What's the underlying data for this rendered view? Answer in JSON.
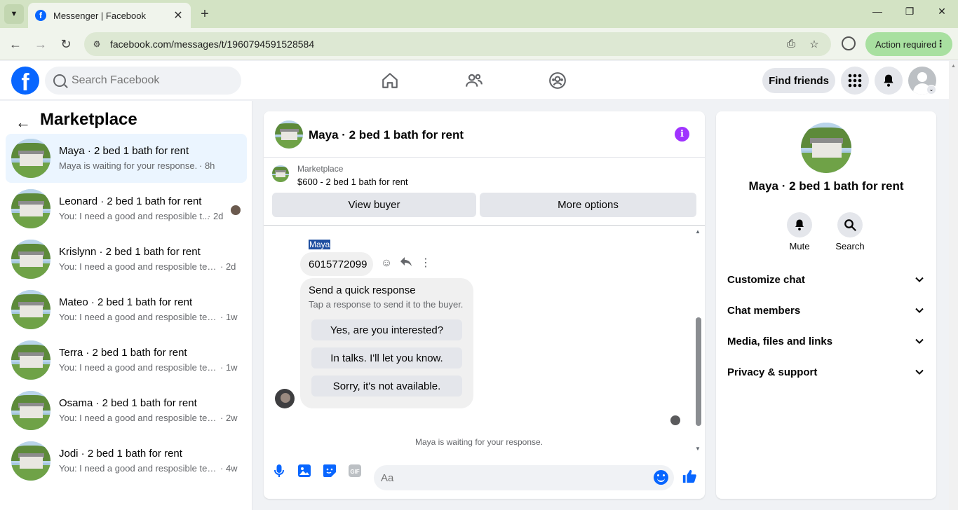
{
  "browser": {
    "tab_title": "Messenger | Facebook",
    "url": "facebook.com/messages/t/1960794591528584",
    "action_required": "Action required"
  },
  "fb": {
    "search_placeholder": "Search Facebook",
    "find_friends": "Find friends"
  },
  "sidebar": {
    "title": "Marketplace",
    "conversations": [
      {
        "name": "Maya · 2 bed 1 bath for rent",
        "preview": "Maya is waiting for your response.",
        "time": "· 8h"
      },
      {
        "name": "Leonard · 2 bed 1 bath for rent",
        "preview": "You: I need a good and resposible t...",
        "time": "· 2d"
      },
      {
        "name": "Krislynn · 2 bed 1 bath for rent",
        "preview": "You: I need a good and resposible ten...",
        "time": "· 2d"
      },
      {
        "name": "Mateo · 2 bed 1 bath for rent",
        "preview": "You: I need a good and resposible ten...",
        "time": "· 1w"
      },
      {
        "name": "Terra · 2 bed 1 bath for rent",
        "preview": "You: I need a good and resposible ten...",
        "time": "· 1w"
      },
      {
        "name": "Osama · 2 bed 1 bath for rent",
        "preview": "You: I need a good and resposible ten...",
        "time": "· 2w"
      },
      {
        "name": "Jodi · 2 bed 1 bath for rent",
        "preview": "You: I need a good and resposible ten...",
        "time": "· 4w"
      }
    ]
  },
  "chat": {
    "title": "Maya · 2 bed 1 bath for rent",
    "listing_source": "Marketplace",
    "listing_price": "$600 - 2 bed 1 bath for rent",
    "view_buyer": "View buyer",
    "more_options": "More options",
    "sender_name": "Maya",
    "phone_message": "6015772099",
    "quick_title": "Send a quick response",
    "quick_sub": "Tap a response to send it to the buyer.",
    "quick_replies": [
      "Yes, are you interested?",
      "In talks. I'll let you know.",
      "Sorry, it's not available."
    ],
    "waiting_note": "Maya is waiting for your response.",
    "composer_placeholder": "Aa"
  },
  "details": {
    "title": "Maya · 2 bed 1 bath for rent",
    "mute": "Mute",
    "search": "Search",
    "sections": [
      "Customize chat",
      "Chat members",
      "Media, files and links",
      "Privacy & support"
    ]
  },
  "colors": {
    "brand": "#0866ff",
    "active_conv": "#ebf5ff",
    "info_purple": "#a033ff",
    "chrome_green": "#d3e3c4"
  }
}
